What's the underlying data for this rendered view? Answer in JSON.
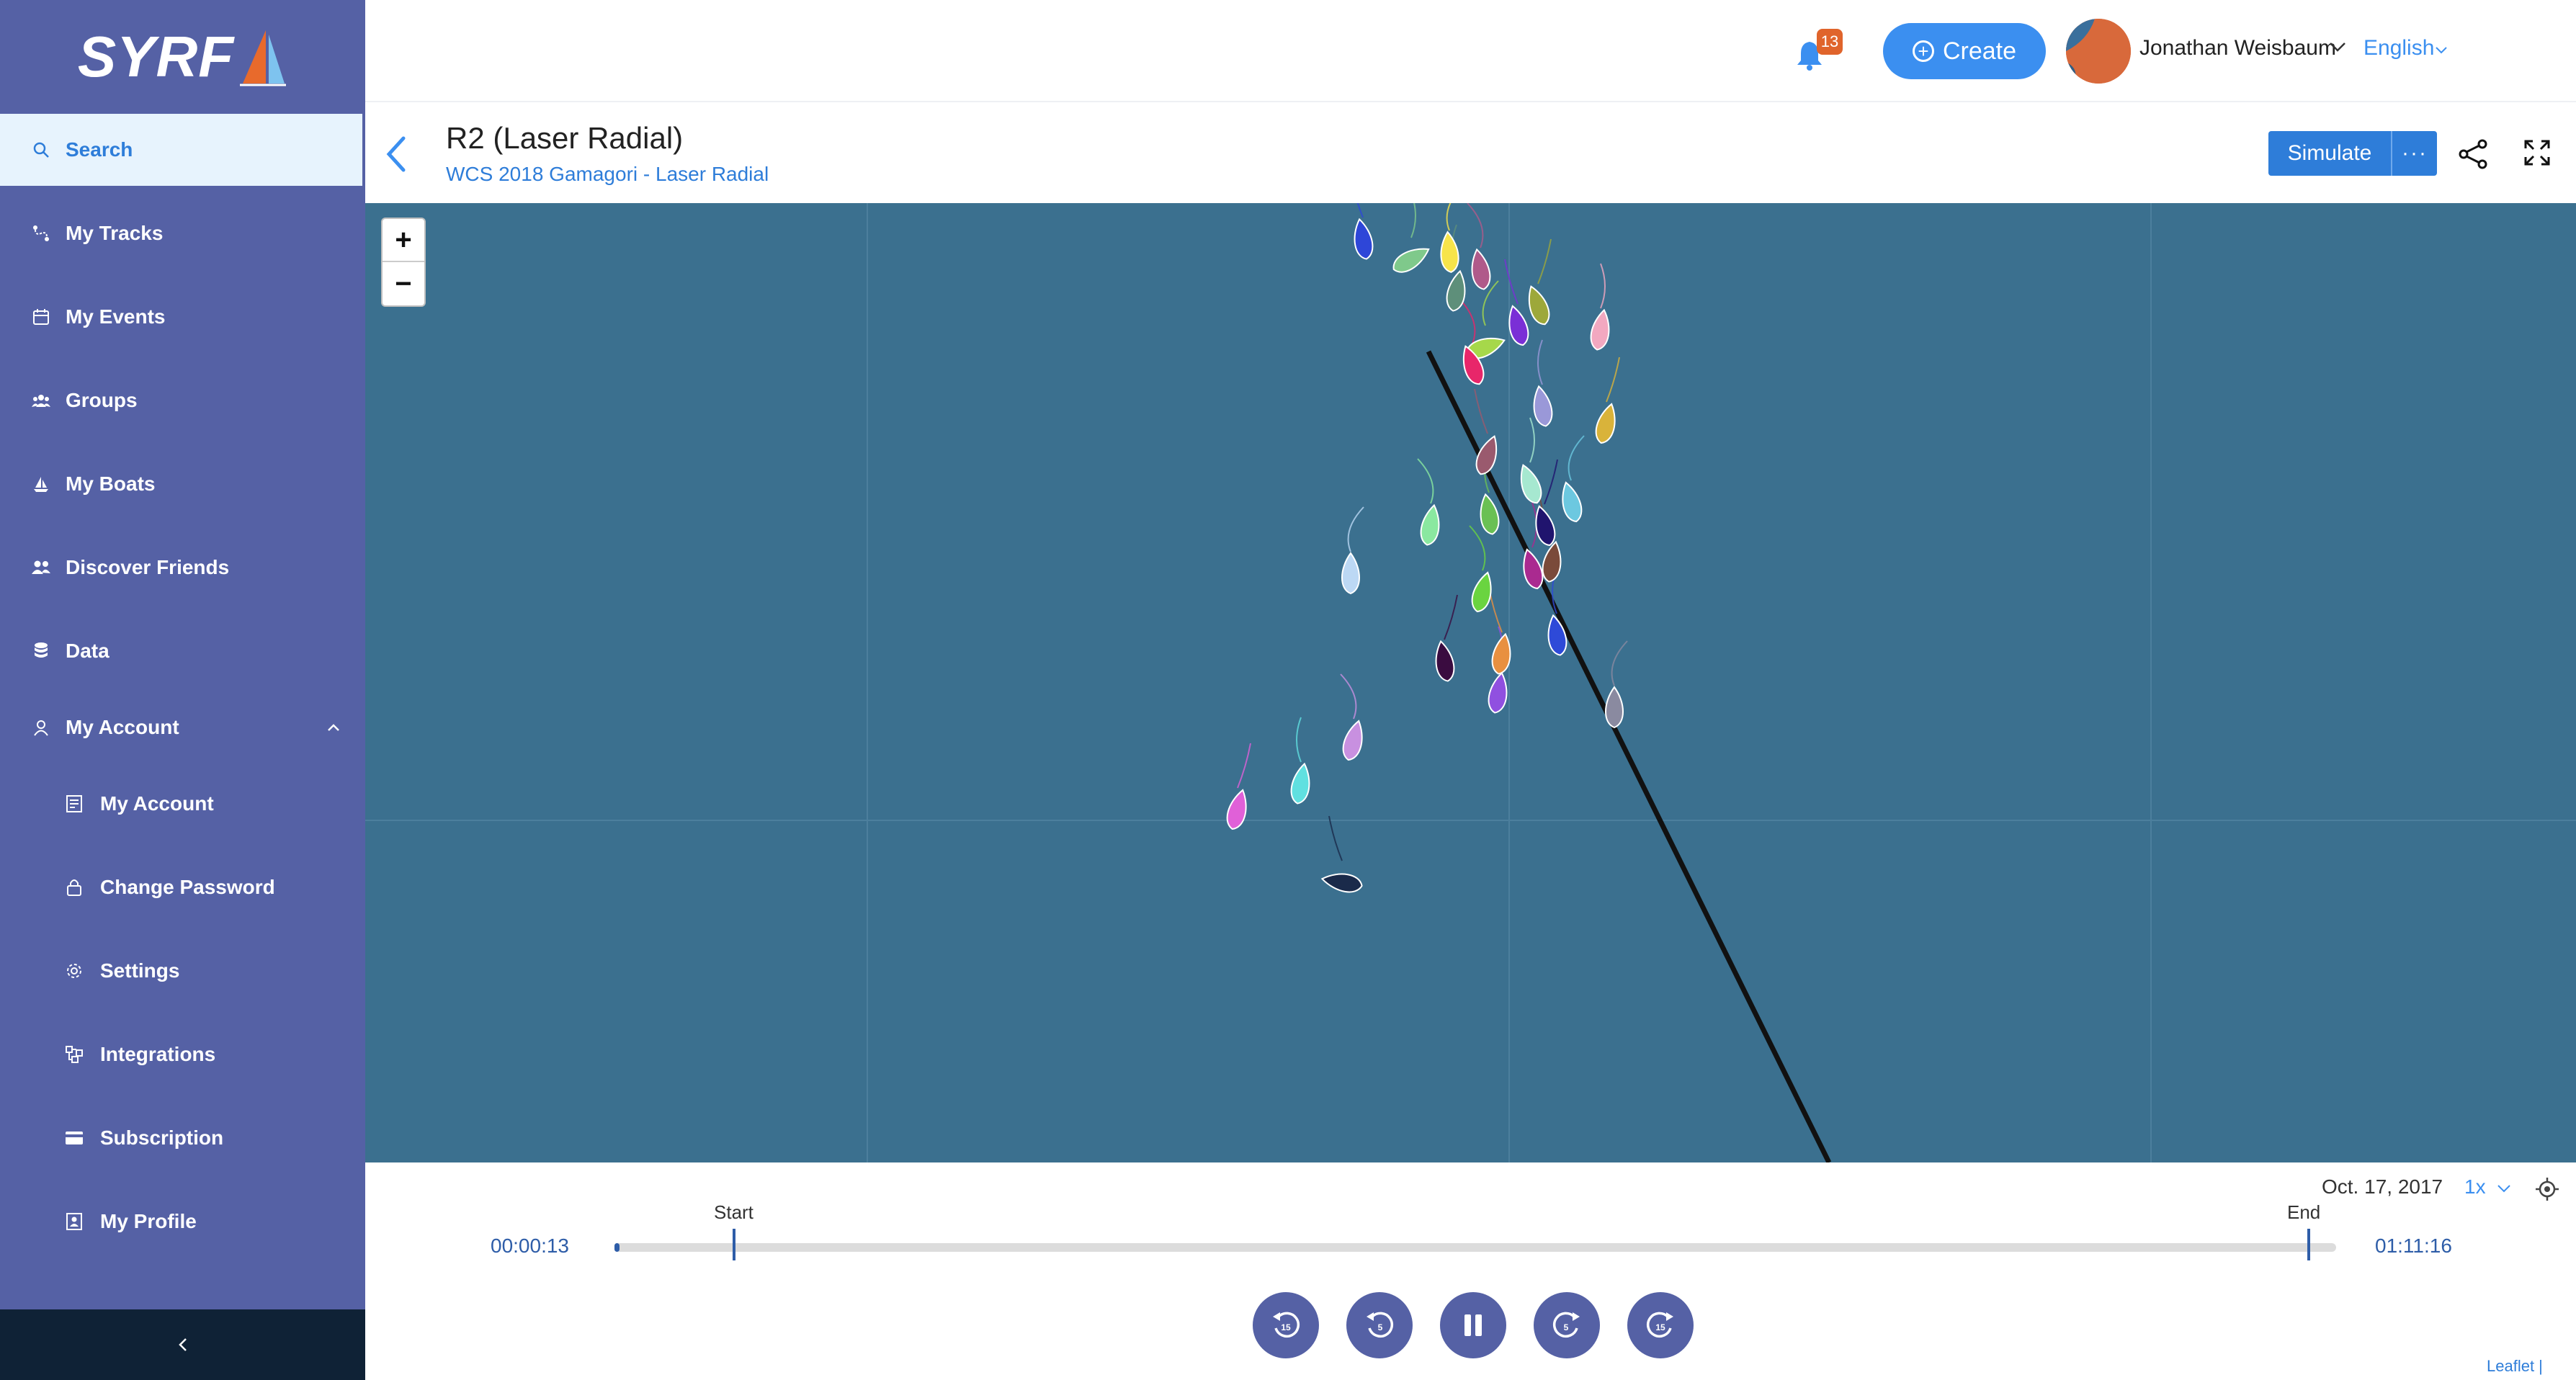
{
  "brand": {
    "logo_text": "SYRF"
  },
  "sidebar": {
    "items": [
      {
        "label": "Search",
        "icon": "search-icon"
      },
      {
        "label": "My Tracks",
        "icon": "tracks-icon"
      },
      {
        "label": "My Events",
        "icon": "calendar-icon"
      },
      {
        "label": "Groups",
        "icon": "groups-icon"
      },
      {
        "label": "My Boats",
        "icon": "boat-icon"
      },
      {
        "label": "Discover Friends",
        "icon": "friends-icon"
      },
      {
        "label": "Data",
        "icon": "database-icon"
      },
      {
        "label": "My Account",
        "icon": "user-icon"
      }
    ],
    "account_sub": [
      {
        "label": "My Account",
        "icon": "document-icon"
      },
      {
        "label": "Change Password",
        "icon": "lock-icon"
      },
      {
        "label": "Settings",
        "icon": "gear-icon"
      },
      {
        "label": "Integrations",
        "icon": "integrations-icon"
      },
      {
        "label": "Subscription",
        "icon": "card-icon"
      },
      {
        "label": "My Profile",
        "icon": "profile-icon"
      }
    ]
  },
  "header": {
    "notification_count": "13",
    "create_label": "Create",
    "user_name": "Jonathan Weisbaum",
    "language": "English"
  },
  "race": {
    "title": "R2 (Laser Radial)",
    "subtitle": "WCS 2018 Gamagori - Laser Radial",
    "simulate_label": "Simulate",
    "more_label": "···"
  },
  "map": {
    "zoom_in": "+",
    "zoom_out": "−",
    "background_color": "#3b708f",
    "boat_count": 40
  },
  "playback": {
    "date": "Oct. 17, 2017",
    "speed": "1x",
    "current_time": "00:00:13",
    "end_time": "01:11:16",
    "start_label": "Start",
    "end_label": "End",
    "progress": 0.003,
    "controls": [
      "rewind-15-icon",
      "rewind-5-icon",
      "pause-icon",
      "forward-5-icon",
      "forward-15-icon"
    ]
  },
  "attribution": "Leaflet |"
}
